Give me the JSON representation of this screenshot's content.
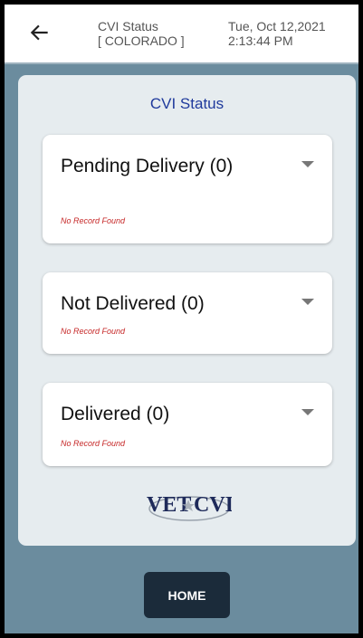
{
  "header": {
    "title_line1": "CVI Status",
    "title_line2": "[ COLORADO ]",
    "date_line1": "Tue, Oct 12,2021",
    "date_line2": "2:13:44 PM"
  },
  "panel": {
    "title": "CVI Status",
    "sections": [
      {
        "label": "Pending Delivery (0)",
        "empty_text": "No Record Found"
      },
      {
        "label": "Not Delivered (0)",
        "empty_text": "No Record Found"
      },
      {
        "label": "Delivered (0)",
        "empty_text": "No Record Found"
      }
    ],
    "logo_text": {
      "left": "VET",
      "right": "CVI"
    }
  },
  "footer": {
    "home_label": "HOME"
  },
  "colors": {
    "background": "#6b8c9e",
    "panel": "#e6ecef",
    "title_blue": "#1f3a9c",
    "error_red": "#c62828",
    "button_dark": "#1b2b3a"
  }
}
